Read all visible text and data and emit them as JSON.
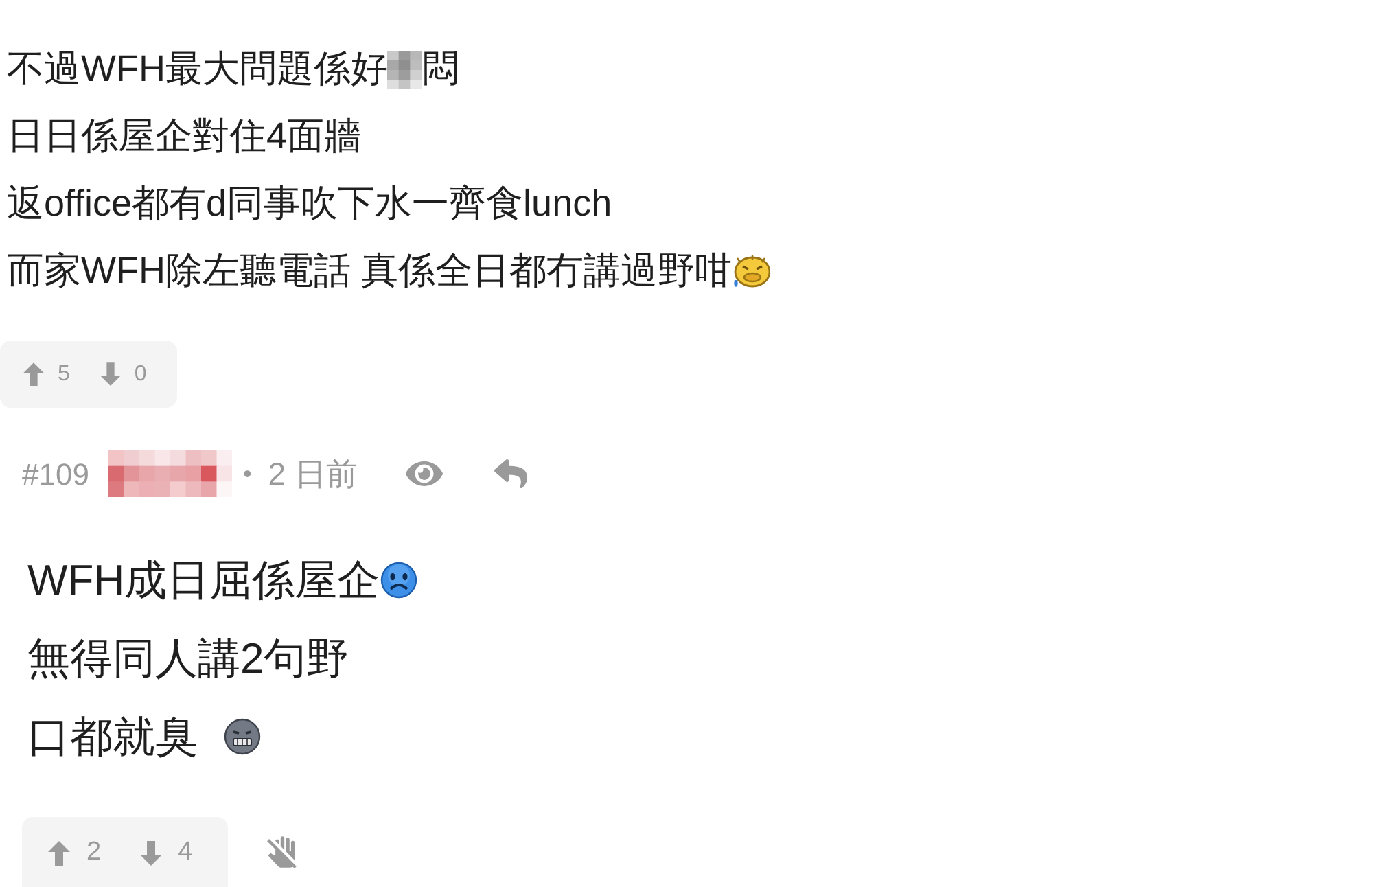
{
  "previous_post": {
    "lines": [
      {
        "parts": [
          {
            "kind": "text",
            "text": "不過WFH最大問題係好"
          },
          {
            "kind": "mosaic"
          },
          {
            "kind": "text",
            "text": "悶"
          }
        ]
      },
      {
        "parts": [
          {
            "kind": "text",
            "text": "日日係屋企對住4面牆"
          }
        ]
      },
      {
        "parts": [
          {
            "kind": "text",
            "text": "返office都有d同事吹下水一齊食lunch"
          }
        ]
      },
      {
        "parts": [
          {
            "kind": "text",
            "text": "而家WFH除左聽電話 真係全日都冇講過野咁"
          },
          {
            "kind": "queasyface"
          }
        ]
      }
    ],
    "votes": {
      "up": "5",
      "down": "0"
    }
  },
  "post": {
    "header": {
      "number": "#109",
      "separator": "•",
      "time": "2 日前"
    },
    "lines": [
      {
        "parts": [
          {
            "kind": "text",
            "text": "WFH成日屈係屋企"
          },
          {
            "kind": "sadface"
          }
        ]
      },
      {
        "parts": [
          {
            "kind": "text",
            "text": "無得同人講2句野"
          }
        ]
      },
      {
        "parts": [
          {
            "kind": "text",
            "text": "口都就臭 "
          },
          {
            "kind": "grimface"
          }
        ]
      }
    ],
    "votes": {
      "up": "2",
      "down": "4"
    }
  }
}
